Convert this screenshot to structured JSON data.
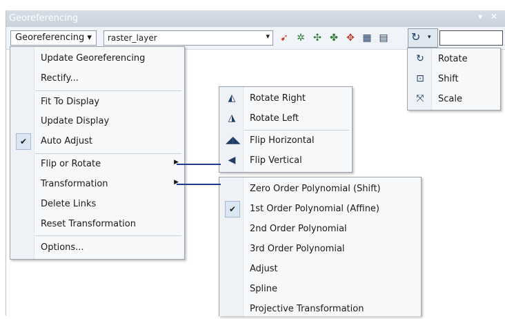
{
  "window": {
    "title": "Georeferencing",
    "controls": "▾ ✕"
  },
  "toolbar": {
    "georef_label": "Georeferencing ▾",
    "layer_value": "raster_layer",
    "icons": [
      "add-control-points-icon",
      "auto-registration-icon",
      "select-link-icon",
      "zoom-to-selected-link-icon",
      "delete-link-icon",
      "view-link-table-icon",
      "view-layer-info-icon"
    ]
  },
  "main_menu": {
    "items": [
      {
        "label": "Update Georeferencing"
      },
      {
        "label": "Rectify..."
      },
      {
        "label": "Fit To Display"
      },
      {
        "label": "Update Display"
      },
      {
        "label": "Auto Adjust",
        "checked": true
      },
      {
        "label": "Flip or Rotate"
      },
      {
        "label": "Transformation"
      },
      {
        "label": "Delete Links"
      },
      {
        "label": "Reset Transformation"
      },
      {
        "label": "Options..."
      }
    ]
  },
  "flip_menu": {
    "items": [
      {
        "label": "Rotate Right",
        "icon": "rotate-right-icon"
      },
      {
        "label": "Rotate Left",
        "icon": "rotate-left-icon"
      },
      {
        "label": "Flip Horizontal",
        "icon": "flip-horizontal-icon"
      },
      {
        "label": "Flip Vertical",
        "icon": "flip-vertical-icon"
      }
    ]
  },
  "transform_menu": {
    "items": [
      {
        "label": "Zero Order Polynomial (Shift)"
      },
      {
        "label": "1st Order Polynomial (Affine)",
        "checked": true
      },
      {
        "label": "2nd Order Polynomial"
      },
      {
        "label": "3rd Order Polynomial"
      },
      {
        "label": "Adjust"
      },
      {
        "label": "Spline"
      },
      {
        "label": "Projective Transformation"
      }
    ]
  },
  "rotate_menu": {
    "items": [
      {
        "label": "Rotate",
        "icon": "rotate-icon"
      },
      {
        "label": "Shift",
        "icon": "shift-icon"
      },
      {
        "label": "Scale",
        "icon": "scale-icon"
      }
    ]
  },
  "glyphs": {
    "check": "✔",
    "submenu": "▶",
    "dropdown": "▾"
  },
  "colors": {
    "connector": "#1f3a8a",
    "title_bar": "#cbd4de",
    "menu_bg": "#f7f8fa"
  }
}
